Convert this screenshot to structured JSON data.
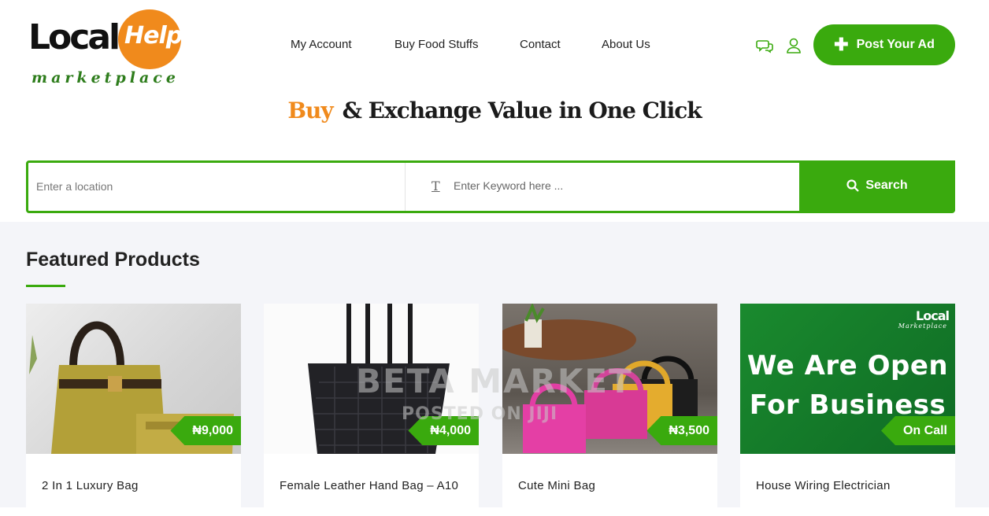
{
  "logo": {
    "local": "Local",
    "help": "Help",
    "tagline": "marketplace"
  },
  "nav": [
    {
      "label": "My Account"
    },
    {
      "label": "Buy Food Stuffs"
    },
    {
      "label": "Contact"
    },
    {
      "label": "About Us"
    }
  ],
  "header_icons": [
    "chat-icon",
    "user-icon"
  ],
  "post_ad": {
    "label": "Post Your Ad"
  },
  "headline": {
    "highlight": "Buy",
    "rest": "& Exchange Value in One Click"
  },
  "search": {
    "location_placeholder": "Enter a location",
    "keyword_placeholder": "Enter Keyword here ...",
    "button_label": "Search"
  },
  "featured": {
    "title": "Featured Products",
    "products": [
      {
        "name": "2 In 1 Luxury Bag",
        "price": "₦9,000"
      },
      {
        "name": "Female Leather Hand Bag – A10",
        "price": "₦4,000"
      },
      {
        "name": "Cute Mini Bag",
        "price": "₦3,500"
      },
      {
        "name": "House Wiring Electrician",
        "price": "On Call",
        "banner_line1": "We Are Open",
        "banner_line2": "For Business",
        "mini_logo": "Local",
        "mini_logo_sub": "Marketplace"
      }
    ]
  },
  "watermark": {
    "line1": "BETA MARKET",
    "line2": "POSTED ON JIJI"
  },
  "colors": {
    "brand_green": "#3aaa0e",
    "brand_orange": "#f08a1c",
    "page_bg": "#f4f5f9"
  }
}
